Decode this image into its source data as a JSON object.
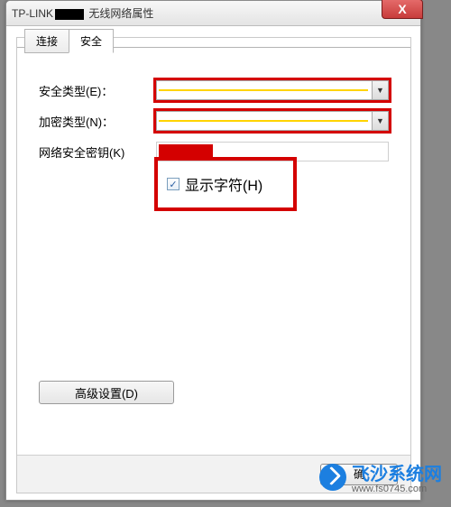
{
  "window": {
    "title_prefix": "TP-LINK",
    "title_suffix": " 无线网络属性",
    "close_symbol": "X"
  },
  "tabs": {
    "connect": "连接",
    "security": "安全"
  },
  "form": {
    "sec_type_label": "安全类型(E)：",
    "enc_type_label": "加密类型(N)：",
    "key_label": "网络安全密钥(K)",
    "show_chars_label": "显示字符(H)",
    "show_chars_checked": "✓"
  },
  "buttons": {
    "advanced": "高级设置(D)",
    "ok": "确"
  },
  "watermark": {
    "name": "飞沙系统网",
    "url": "www.fs0745.com"
  }
}
